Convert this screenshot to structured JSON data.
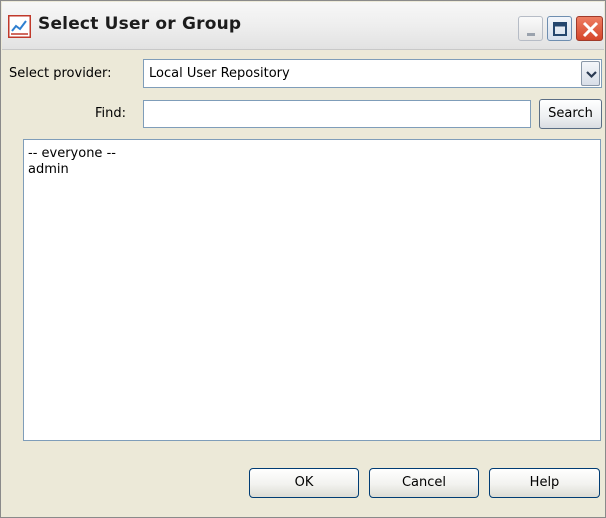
{
  "window": {
    "title": "Select User or Group",
    "app_icon": "chart-app-icon",
    "controls": {
      "minimize_icon": "minimize-icon",
      "maximize_icon": "maximize-icon",
      "close_icon": "close-icon"
    }
  },
  "provider": {
    "label": "Select provider:",
    "selected": "Local User Repository",
    "arrow_icon": "chevron-down-icon"
  },
  "find": {
    "label": "Find:",
    "value": "",
    "placeholder": "",
    "search_label": "Search"
  },
  "results": {
    "items": [
      "-- everyone --",
      "admin"
    ]
  },
  "buttons": {
    "ok": "OK",
    "cancel": "Cancel",
    "help": "Help"
  },
  "colors": {
    "dialog_bg": "#ece9d8",
    "field_border": "#7f9db9",
    "close_red": "#d5462a"
  }
}
